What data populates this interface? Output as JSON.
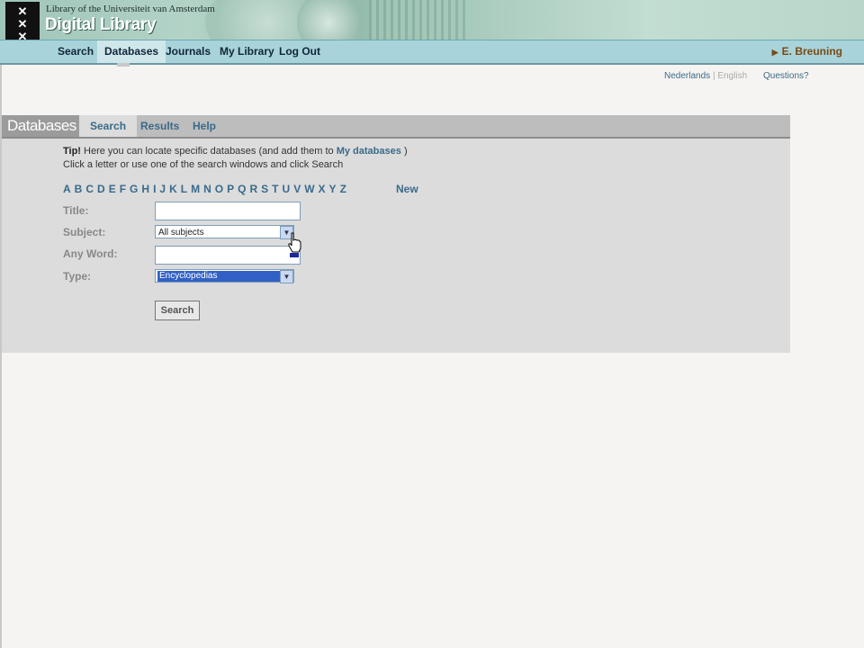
{
  "header": {
    "library_name": "Library of the Universiteit van Amsterdam",
    "title": "Digital Library",
    "logo_glyphs": [
      "✕",
      "✕",
      "✕"
    ]
  },
  "topnav": {
    "items": [
      {
        "label": "Search"
      },
      {
        "label": "Databases",
        "active": true
      },
      {
        "label": "Journals"
      },
      {
        "label": "My Library"
      },
      {
        "label": "Log Out"
      }
    ],
    "user": "E. Breuning"
  },
  "language": {
    "nederlands": "Nederlands",
    "separator": "|",
    "english": "English",
    "questions": "Questions?"
  },
  "panel": {
    "title": "Databases",
    "tabs": [
      {
        "label": "Search",
        "active": true
      },
      {
        "label": "Results"
      },
      {
        "label": "Help"
      }
    ],
    "tip_label": "Tip!",
    "tip_text": "Here you can locate specific databases (and add them to",
    "tip_link": "My databases",
    "tip_close": ")",
    "tip_line2": "Click a letter or use one of the search windows and click Search",
    "letters": [
      "A",
      "B",
      "C",
      "D",
      "E",
      "F",
      "G",
      "H",
      "I",
      "J",
      "K",
      "L",
      "M",
      "N",
      "O",
      "P",
      "Q",
      "R",
      "S",
      "T",
      "U",
      "V",
      "W",
      "X",
      "Y",
      "Z"
    ],
    "new_label": "New"
  },
  "form": {
    "title_label": "Title:",
    "title_value": "",
    "subject_label": "Subject:",
    "subject_value": "All subjects",
    "anyword_label": "Any Word:",
    "anyword_value": "",
    "type_label": "Type:",
    "type_value": "Encyclopedias",
    "search_button": "Search"
  },
  "colors": {
    "accent_link": "#3a6a8a",
    "nav_bg": "#a8d3da",
    "user_color": "#7a4a12",
    "selection": "#3161c6"
  }
}
